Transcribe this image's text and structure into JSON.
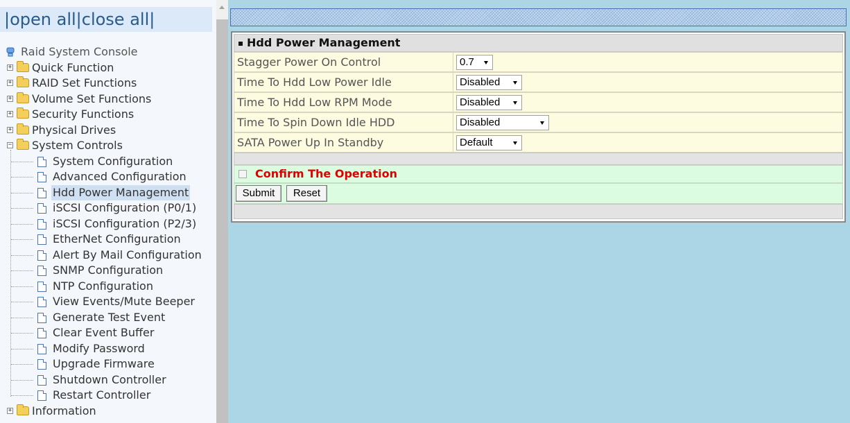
{
  "toolbar": {
    "open_all": "|open all",
    "close_all": "|close all|"
  },
  "tree": {
    "root": "Raid System Console",
    "folders": [
      {
        "label": "Quick Function",
        "expanded": false
      },
      {
        "label": "RAID Set Functions",
        "expanded": false
      },
      {
        "label": "Volume Set Functions",
        "expanded": false
      },
      {
        "label": "Security Functions",
        "expanded": false
      },
      {
        "label": "Physical Drives",
        "expanded": false
      },
      {
        "label": "System Controls",
        "expanded": true
      },
      {
        "label": "Information",
        "expanded": false
      }
    ],
    "system_controls_items": [
      "System Configuration",
      "Advanced Configuration",
      "Hdd Power Management",
      "iSCSI Configuration (P0/1)",
      "iSCSI Configuration (P2/3)",
      "EtherNet Configuration",
      "Alert By Mail Configuration",
      "SNMP Configuration",
      "NTP Configuration",
      "View Events/Mute Beeper",
      "Generate Test Event",
      "Clear Event Buffer",
      "Modify Password",
      "Upgrade Firmware",
      "Shutdown Controller",
      "Restart Controller"
    ],
    "selected": "Hdd Power Management"
  },
  "form": {
    "title": "Hdd Power Management",
    "fields": [
      {
        "label": "Stagger Power On Control",
        "value": "0.7"
      },
      {
        "label": "Time To Hdd Low Power Idle",
        "value": "Disabled"
      },
      {
        "label": "Time To Hdd Low RPM Mode",
        "value": "Disabled"
      },
      {
        "label": "Time To Spin Down Idle HDD",
        "value": "Disabled"
      },
      {
        "label": "SATA Power Up In Standby",
        "value": "Default"
      }
    ],
    "confirm_label": "Confirm The Operation",
    "confirm_checked": false,
    "submit_label": "Submit",
    "reset_label": "Reset"
  },
  "colors": {
    "content_bg": "#acd6e6",
    "field_bg": "#fdfce0",
    "confirm_bg": "#dbfce0",
    "confirm_text": "#e00000",
    "toolbar_bg": "#dbe9f8"
  },
  "icons": {
    "root": "server-icon",
    "folder": "folder-icon",
    "page": "document-icon",
    "expand": "plus-box-icon",
    "collapse": "minus-box-icon"
  }
}
